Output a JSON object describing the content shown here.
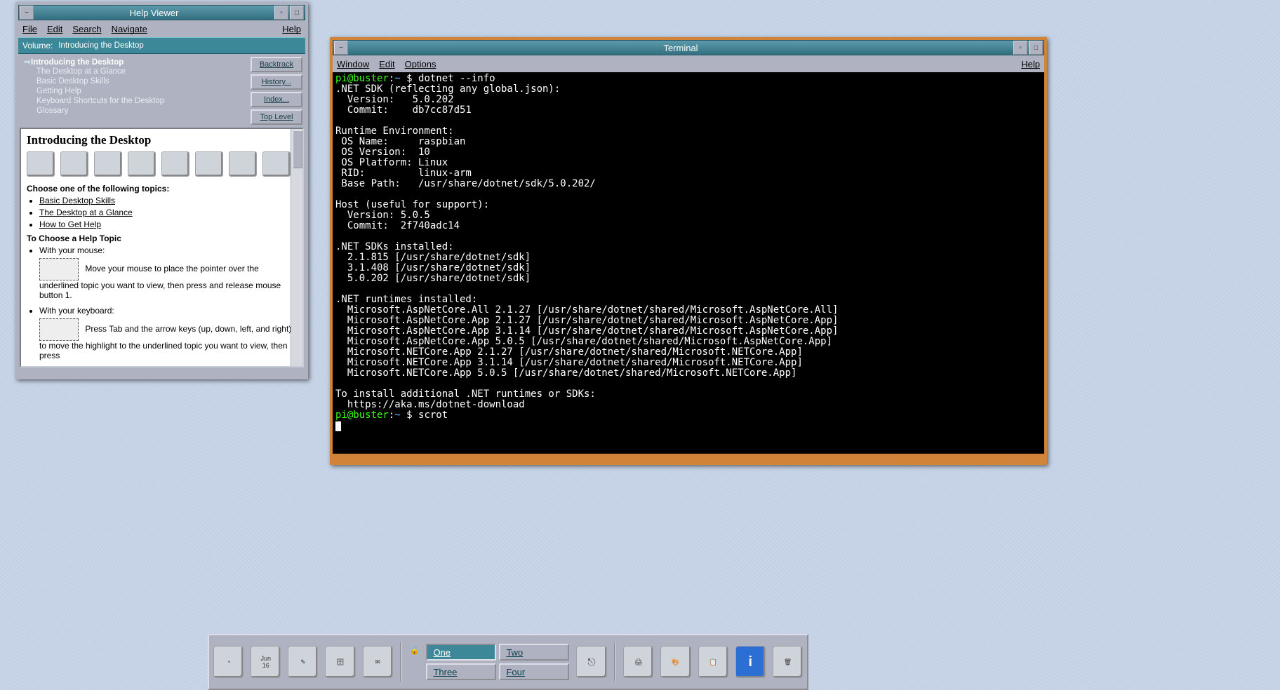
{
  "help_viewer": {
    "title": "Help Viewer",
    "menu": [
      "File",
      "Edit",
      "Search",
      "Navigate"
    ],
    "menu_help": "Help",
    "volume_label": "Volume:",
    "volume_value": "Introducing the Desktop",
    "nav_root": "Introducing the Desktop",
    "nav_items": [
      "The Desktop at a Glance",
      "Basic Desktop Skills",
      "Getting Help",
      "Keyboard Shortcuts for the Desktop",
      "Glossary"
    ],
    "buttons": {
      "backtrack": "Backtrack",
      "history": "History...",
      "index": "Index...",
      "top": "Top Level"
    },
    "doc": {
      "heading": "Introducing the Desktop",
      "choose_label": "Choose one of the following topics:",
      "links": [
        "Basic Desktop Skills",
        "The Desktop at a Glance",
        "How to Get Help"
      ],
      "to_choose_label": "To Choose a Help Topic",
      "mouse_label": "With your mouse:",
      "mouse_text": "Move your mouse to place the pointer over the underlined topic you want to view, then press and release mouse button 1.",
      "kbd_label": "With your keyboard:",
      "kbd_text": "Press Tab and the arrow keys (up, down, left, and right) to move the highlight to the underlined topic you want to view, then press"
    }
  },
  "terminal": {
    "title": "Terminal",
    "menu": [
      "Window",
      "Edit",
      "Options"
    ],
    "menu_help": "Help",
    "prompt_user": "pi@buster",
    "prompt_path": "~",
    "prompt_sym": "$",
    "commands": {
      "cmd1": "dotnet --info",
      "cmd2": "scrot"
    },
    "output": ".NET SDK (reflecting any global.json):\n  Version:   5.0.202\n  Commit:    db7cc87d51\n\nRuntime Environment:\n OS Name:     raspbian\n OS Version:  10\n OS Platform: Linux\n RID:         linux-arm\n Base Path:   /usr/share/dotnet/sdk/5.0.202/\n\nHost (useful for support):\n  Version: 5.0.5\n  Commit:  2f740adc14\n\n.NET SDKs installed:\n  2.1.815 [/usr/share/dotnet/sdk]\n  3.1.408 [/usr/share/dotnet/sdk]\n  5.0.202 [/usr/share/dotnet/sdk]\n\n.NET runtimes installed:\n  Microsoft.AspNetCore.All 2.1.27 [/usr/share/dotnet/shared/Microsoft.AspNetCore.All]\n  Microsoft.AspNetCore.App 2.1.27 [/usr/share/dotnet/shared/Microsoft.AspNetCore.App]\n  Microsoft.AspNetCore.App 3.1.14 [/usr/share/dotnet/shared/Microsoft.AspNetCore.App]\n  Microsoft.AspNetCore.App 5.0.5 [/usr/share/dotnet/shared/Microsoft.AspNetCore.App]\n  Microsoft.NETCore.App 2.1.27 [/usr/share/dotnet/shared/Microsoft.NETCore.App]\n  Microsoft.NETCore.App 3.1.14 [/usr/share/dotnet/shared/Microsoft.NETCore.App]\n  Microsoft.NETCore.App 5.0.5 [/usr/share/dotnet/shared/Microsoft.NETCore.App]\n\nTo install additional .NET runtimes or SDKs:\n  https://aka.ms/dotnet-download"
  },
  "taskbar": {
    "date_month": "Jun",
    "date_day": "16",
    "pager": [
      "One",
      "Two",
      "Three",
      "Four"
    ],
    "pager_active": 0
  }
}
